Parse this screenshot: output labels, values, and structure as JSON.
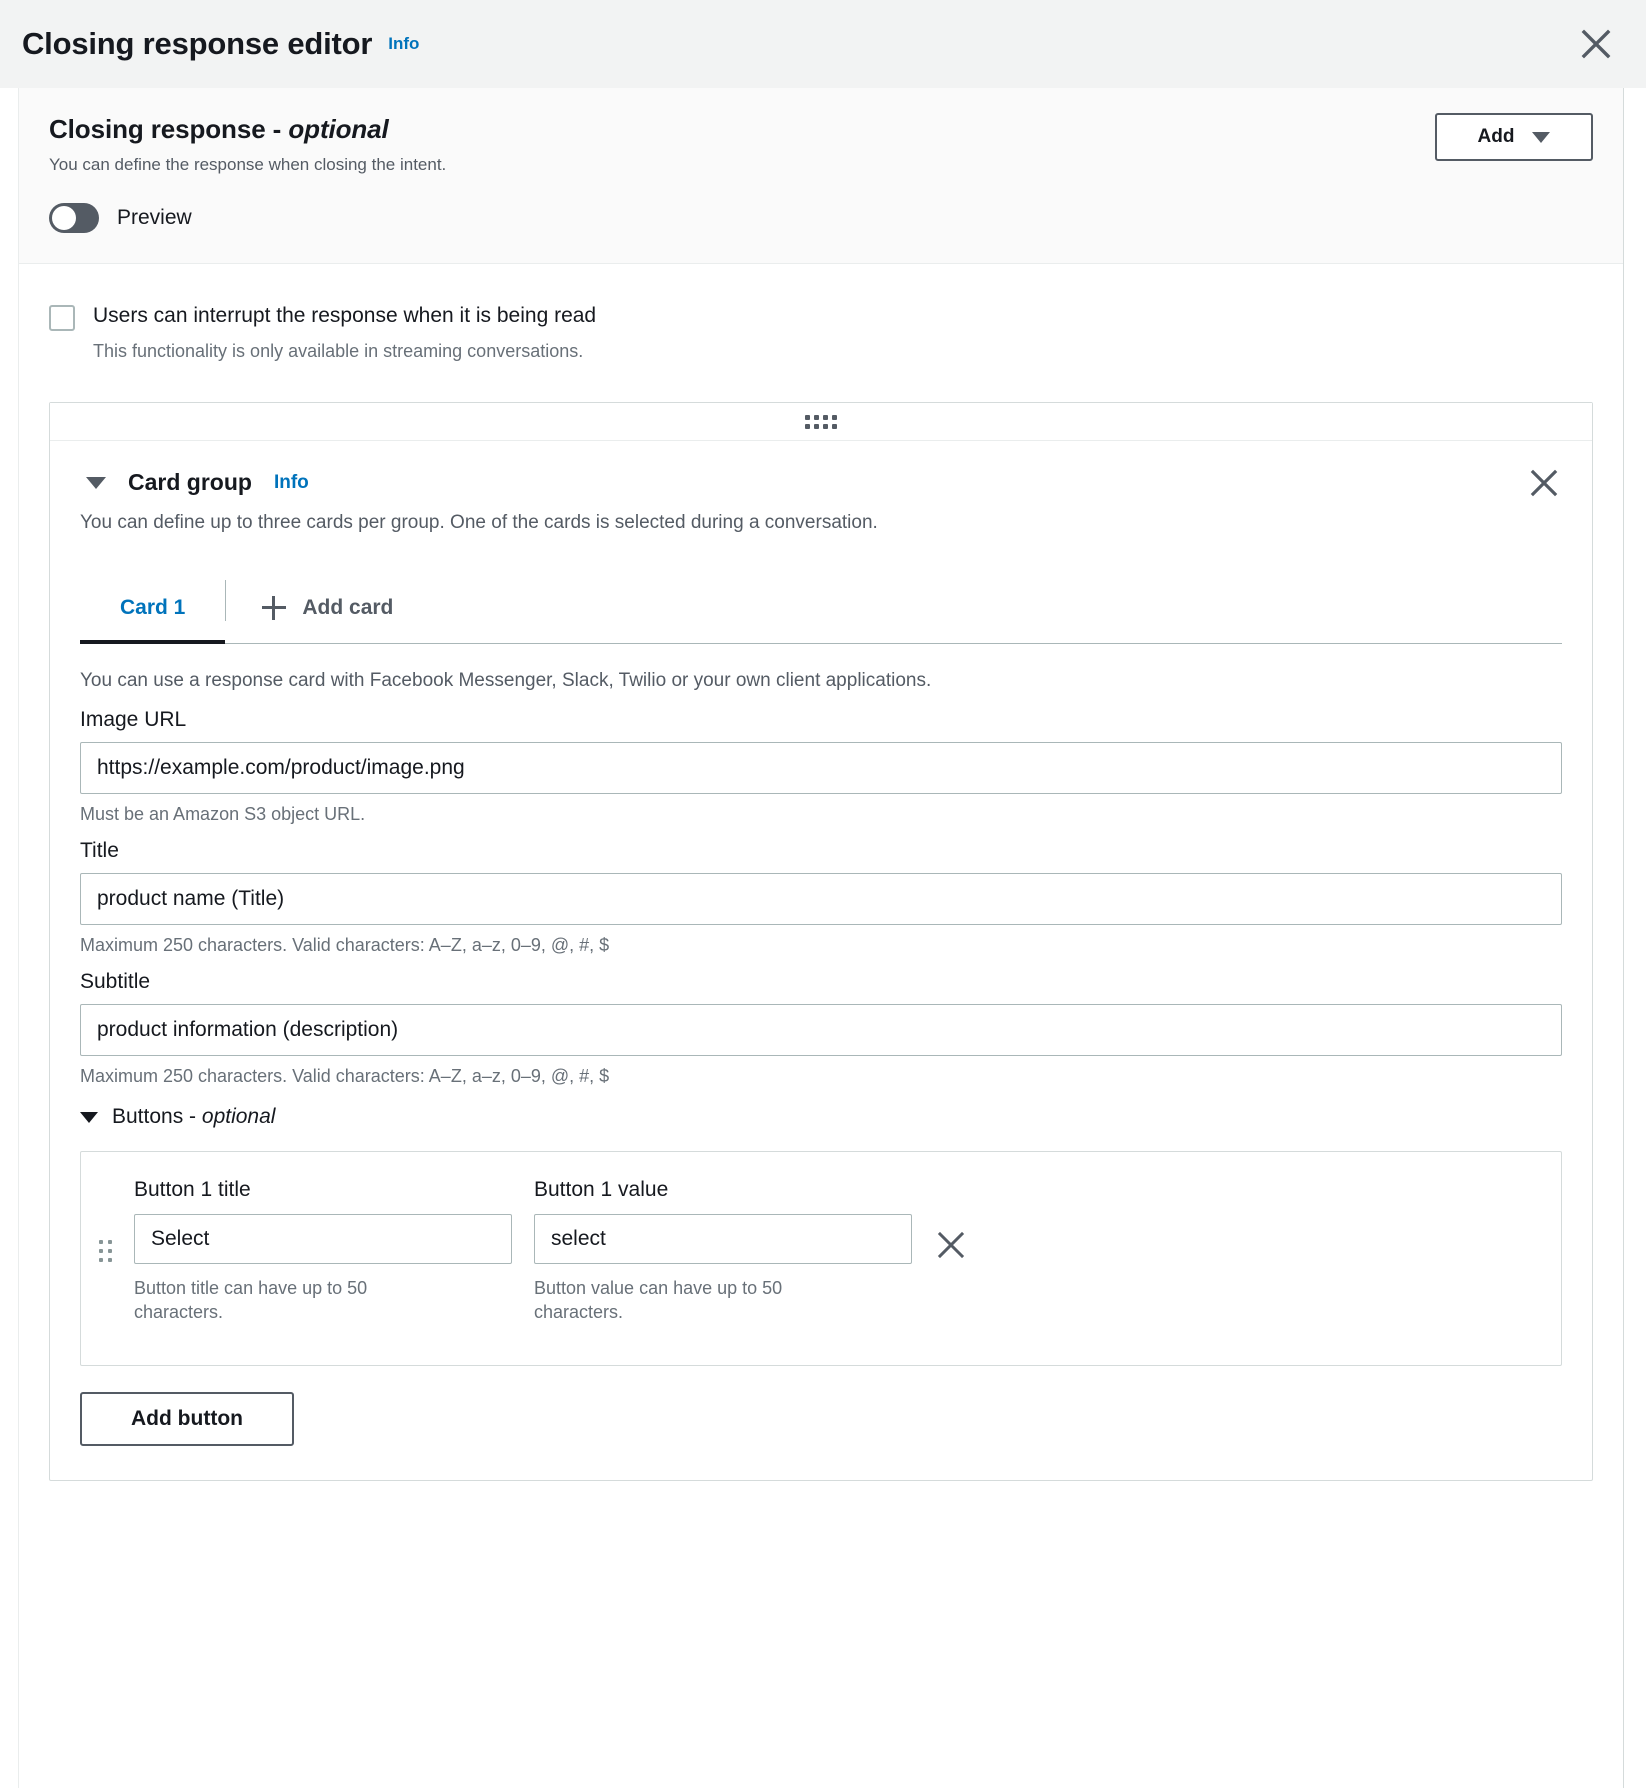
{
  "modal": {
    "title": "Closing response editor",
    "info_label": "Info",
    "close_icon": "close-icon"
  },
  "panel": {
    "heading_main": "Closing response - ",
    "heading_optional": "optional",
    "description": "You can define the response when closing the intent.",
    "add_button_label": "Add",
    "add_button_icon": "chevron-down-icon",
    "preview_toggle_label": "Preview",
    "preview_toggle_on": false
  },
  "interrupt": {
    "checkbox_label": "Users can interrupt the response when it is being read",
    "checkbox_checked": false,
    "hint": "This functionality is only available in streaming conversations."
  },
  "card_group": {
    "drag_handle_icon": "drag-handle-icon",
    "collapse_icon": "triangle-down-icon",
    "title": "Card group",
    "info_label": "Info",
    "close_icon": "close-icon",
    "description": "You can define up to three cards per group. One of the cards is selected during a conversation.",
    "tabs": [
      {
        "label": "Card 1",
        "active": true
      }
    ],
    "add_card_label": "Add card",
    "add_card_icon": "plus-icon"
  },
  "card": {
    "intro_hint": "You can use a response card with Facebook Messenger, Slack, Twilio or your own client applications.",
    "image_url": {
      "label": "Image URL",
      "value": "https://example.com/product/image.png",
      "hint": "Must be an Amazon S3 object URL."
    },
    "title_field": {
      "label": "Title",
      "value": "product name (Title)",
      "hint": "Maximum 250 characters. Valid characters: A–Z, a–z, 0–9, @, #, $"
    },
    "subtitle_field": {
      "label": "Subtitle",
      "value": "product information (description)",
      "hint": "Maximum 250 characters. Valid characters: A–Z, a–z, 0–9, @, #, $"
    },
    "buttons_section": {
      "collapse_icon": "triangle-down-icon",
      "label_main": "Buttons - ",
      "label_optional": "optional",
      "rows": [
        {
          "drag_icon": "drag-handle-icon",
          "title_label": "Button 1 title",
          "title_value": "Select",
          "title_hint": "Button title can have up to 50 characters.",
          "value_label": "Button 1 value",
          "value_value": "select",
          "value_hint": "Button value can have up to 50 characters.",
          "remove_icon": "close-icon"
        }
      ],
      "add_button_label": "Add button"
    }
  },
  "colors": {
    "link": "#0073bb",
    "text": "#16191f",
    "muted": "#545b64",
    "hint": "#687078",
    "border": "#aab7b8",
    "panel_bg": "#f2f3f3"
  }
}
